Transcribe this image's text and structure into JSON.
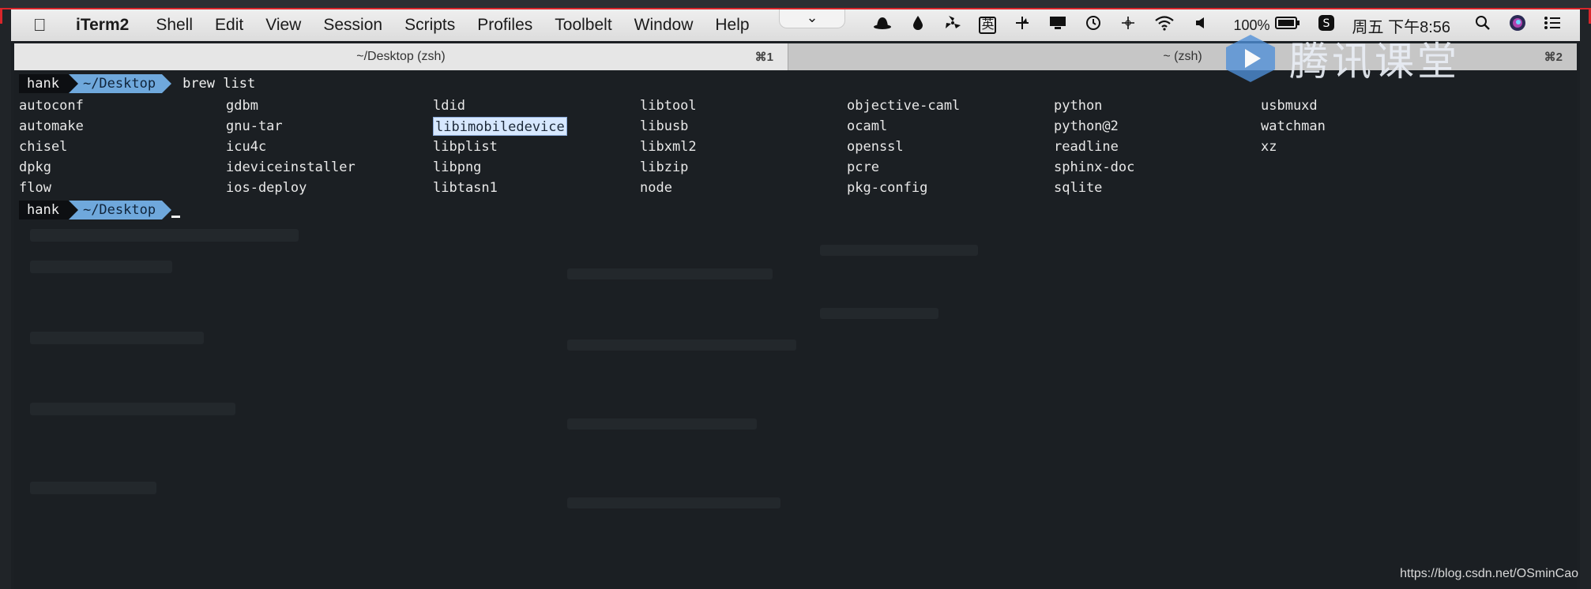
{
  "menubar": {
    "apple_icon": "apple-logo-icon",
    "items": [
      "iTerm2",
      "Shell",
      "Edit",
      "View",
      "Session",
      "Scripts",
      "Profiles",
      "Toolbelt",
      "Window",
      "Help"
    ],
    "status": {
      "battery": "100%",
      "clock": "周五 下午8:56",
      "icons": [
        "hat-icon",
        "drop-icon",
        "fan-icon",
        "input-method-icon",
        "pinwheel-icon",
        "display-icon",
        "time-machine-icon",
        "move-icon",
        "wifi-icon",
        "volume-icon",
        "battery-icon",
        "sogou-icon",
        "search-icon",
        "siri-icon",
        "list-icon"
      ],
      "input_method_glyph": "英"
    }
  },
  "tabs": [
    {
      "title": "~/Desktop (zsh)",
      "shortcut": "⌘1",
      "active": true
    },
    {
      "title": "~ (zsh)",
      "shortcut": "⌘2",
      "active": false
    }
  ],
  "terminal": {
    "prompt_user": "hank",
    "prompt_dir": "~/Desktop",
    "command": "brew list",
    "columns": [
      [
        "autoconf",
        "automake",
        "chisel",
        "dpkg",
        "flow"
      ],
      [
        "gdbm",
        "gnu-tar",
        "icu4c",
        "ideviceinstaller",
        "ios-deploy"
      ],
      [
        "ldid",
        "libimobiledevice",
        "libplist",
        "libpng",
        "libtasn1"
      ],
      [
        "libtool",
        "libusb",
        "libxml2",
        "libzip",
        "node"
      ],
      [
        "objective-caml",
        "ocaml",
        "openssl",
        "pcre",
        "pkg-config"
      ],
      [
        "python",
        "python@2",
        "readline",
        "sphinx-doc",
        "sqlite"
      ],
      [
        "usbmuxd",
        "watchman",
        "xz"
      ]
    ],
    "selected": "libimobiledevice"
  },
  "watermark": {
    "text": "腾讯课堂"
  },
  "footer": {
    "url": "https://blog.csdn.net/OSminCao"
  },
  "colors": {
    "prompt_dir_bg": "#6fa8dc",
    "terminal_bg": "#1b1f23",
    "selection_bg": "#d7e8ff"
  }
}
